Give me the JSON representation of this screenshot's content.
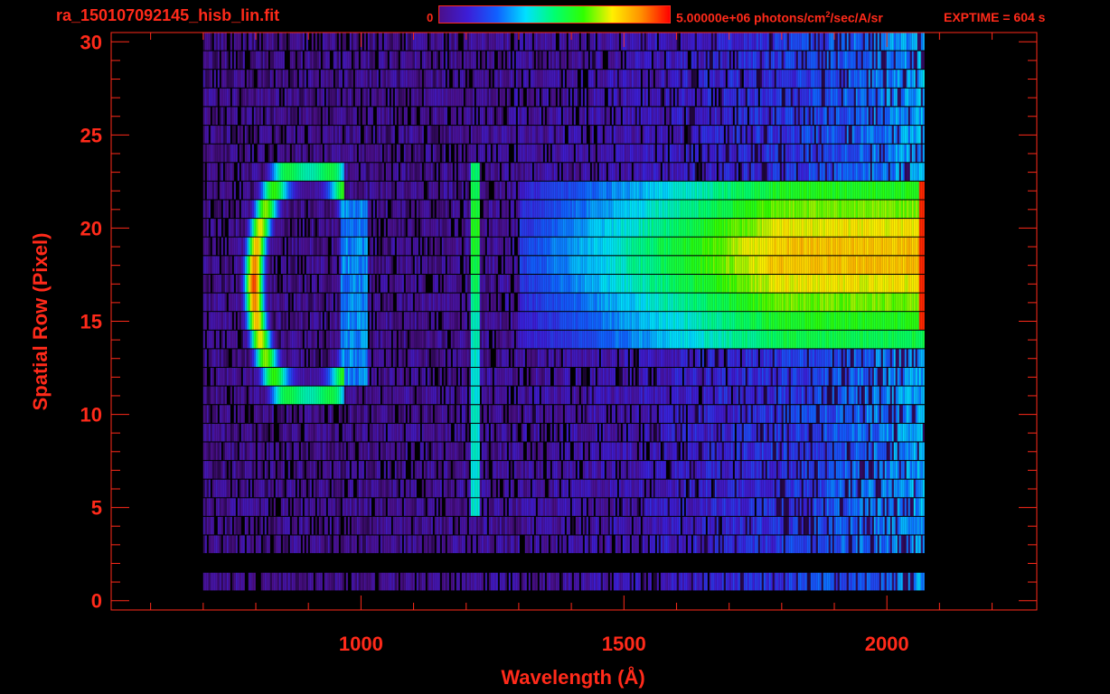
{
  "header": {
    "file_title": "ra_150107092145_hisb_lin.fit",
    "colorbar_min": "0",
    "colorbar_max_value": "5.00000e+06",
    "colorbar_units_pre": " photons/cm",
    "colorbar_units_sup": "2",
    "colorbar_units_post": "/sec/A/sr",
    "exptime": "EXPTIME = 604 s"
  },
  "colors": {
    "axis": "#ff2a1a",
    "background": "#000000",
    "colormap": [
      "#000000",
      "#4b0f8a",
      "#3c1ed8",
      "#1060ff",
      "#00e0ff",
      "#00ff70",
      "#30ff00",
      "#fff000",
      "#ff9000",
      "#ff0000"
    ]
  },
  "chart_data": {
    "type": "heatmap",
    "xlabel": "Wavelength (Å)",
    "ylabel": "Spatial Row (Pixel)",
    "xlim": [
      525,
      2285
    ],
    "ylim": [
      -0.5,
      30.5
    ],
    "x_ticks": [
      1000,
      1500,
      2000
    ],
    "x_tick_labels": [
      "1000",
      "1500",
      "2000"
    ],
    "y_ticks": [
      0,
      5,
      10,
      15,
      20,
      25,
      30
    ],
    "y_tick_labels": [
      "0",
      "5",
      "10",
      "15",
      "20",
      "25",
      "30"
    ],
    "colorbar": {
      "min": 0,
      "max": 5000000,
      "colormap": "rainbow"
    },
    "data_extent": {
      "x_start": 700,
      "x_end": 2070,
      "row_start": 0,
      "row_end": 30
    },
    "features": [
      {
        "name": "arc",
        "x_range": [
          790,
          960
        ],
        "rows": [
          11,
          23
        ],
        "level": 0.9
      },
      {
        "name": "line",
        "x": 1215,
        "rows": [
          5,
          24
        ],
        "level": 0.55
      },
      {
        "name": "band",
        "x_range": [
          1500,
          2065
        ],
        "rows": [
          14,
          23
        ],
        "level": 0.75
      }
    ]
  }
}
